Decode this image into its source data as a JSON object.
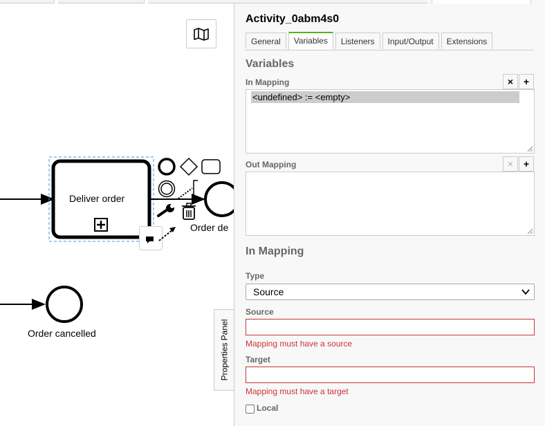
{
  "canvas": {
    "labels": {
      "task": "Deliver order",
      "end_event_partial": "Order de",
      "cancel_event": "Order cancelled"
    },
    "icons": {
      "minimap": "map-icon",
      "subprocess_marker": "plus-square-icon",
      "context_pad": [
        "end-event-circle-icon",
        "gateway-diamond-icon",
        "task-rectangle-icon",
        "intermediate-event-icon",
        "text-annotation-bracket-icon",
        "wrench-icon",
        "trash-icon",
        "comment-icon",
        "connect-arrow-icon",
        "sequence-flow-icon"
      ]
    }
  },
  "panel_toggle": {
    "label": "Properties Panel"
  },
  "panel": {
    "title": "Activity_0abm4s0",
    "tabs": [
      {
        "label": "General",
        "active": false
      },
      {
        "label": "Variables",
        "active": true
      },
      {
        "label": "Listeners",
        "active": false
      },
      {
        "label": "Input/Output",
        "active": false
      },
      {
        "label": "Extensions",
        "active": false
      }
    ],
    "variables_heading": "Variables",
    "in_mapping": {
      "label": "In Mapping",
      "remove_button": "×",
      "add_button": "+",
      "rows": [
        "<undefined> := <empty>"
      ]
    },
    "out_mapping": {
      "label": "Out Mapping",
      "remove_button": "×",
      "add_button": "+",
      "rows": []
    },
    "detail_heading": "In Mapping",
    "type": {
      "label": "Type",
      "value": "Source"
    },
    "source": {
      "label": "Source",
      "value": "",
      "error": "Mapping must have a source"
    },
    "target": {
      "label": "Target",
      "value": "",
      "error": "Mapping must have a target"
    },
    "local": {
      "label": "Local",
      "checked": false
    },
    "accent_color": "#52b415",
    "error_color": "#cc3333"
  }
}
